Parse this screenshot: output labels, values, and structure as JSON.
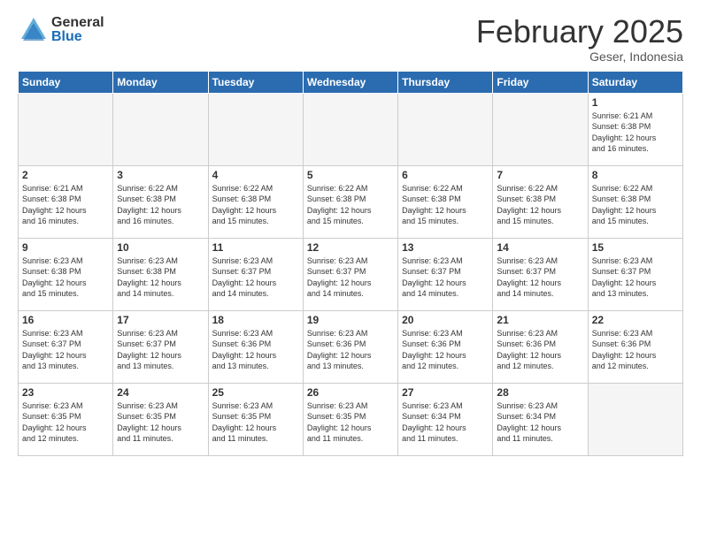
{
  "header": {
    "logo": {
      "general": "General",
      "blue": "Blue"
    },
    "title": "February 2025",
    "subtitle": "Geser, Indonesia"
  },
  "weekdays": [
    "Sunday",
    "Monday",
    "Tuesday",
    "Wednesday",
    "Thursday",
    "Friday",
    "Saturday"
  ],
  "weeks": [
    [
      {
        "day": "",
        "info": ""
      },
      {
        "day": "",
        "info": ""
      },
      {
        "day": "",
        "info": ""
      },
      {
        "day": "",
        "info": ""
      },
      {
        "day": "",
        "info": ""
      },
      {
        "day": "",
        "info": ""
      },
      {
        "day": "1",
        "info": "Sunrise: 6:21 AM\nSunset: 6:38 PM\nDaylight: 12 hours\nand 16 minutes."
      }
    ],
    [
      {
        "day": "2",
        "info": "Sunrise: 6:21 AM\nSunset: 6:38 PM\nDaylight: 12 hours\nand 16 minutes."
      },
      {
        "day": "3",
        "info": "Sunrise: 6:22 AM\nSunset: 6:38 PM\nDaylight: 12 hours\nand 16 minutes."
      },
      {
        "day": "4",
        "info": "Sunrise: 6:22 AM\nSunset: 6:38 PM\nDaylight: 12 hours\nand 15 minutes."
      },
      {
        "day": "5",
        "info": "Sunrise: 6:22 AM\nSunset: 6:38 PM\nDaylight: 12 hours\nand 15 minutes."
      },
      {
        "day": "6",
        "info": "Sunrise: 6:22 AM\nSunset: 6:38 PM\nDaylight: 12 hours\nand 15 minutes."
      },
      {
        "day": "7",
        "info": "Sunrise: 6:22 AM\nSunset: 6:38 PM\nDaylight: 12 hours\nand 15 minutes."
      },
      {
        "day": "8",
        "info": "Sunrise: 6:22 AM\nSunset: 6:38 PM\nDaylight: 12 hours\nand 15 minutes."
      }
    ],
    [
      {
        "day": "9",
        "info": "Sunrise: 6:23 AM\nSunset: 6:38 PM\nDaylight: 12 hours\nand 15 minutes."
      },
      {
        "day": "10",
        "info": "Sunrise: 6:23 AM\nSunset: 6:38 PM\nDaylight: 12 hours\nand 14 minutes."
      },
      {
        "day": "11",
        "info": "Sunrise: 6:23 AM\nSunset: 6:37 PM\nDaylight: 12 hours\nand 14 minutes."
      },
      {
        "day": "12",
        "info": "Sunrise: 6:23 AM\nSunset: 6:37 PM\nDaylight: 12 hours\nand 14 minutes."
      },
      {
        "day": "13",
        "info": "Sunrise: 6:23 AM\nSunset: 6:37 PM\nDaylight: 12 hours\nand 14 minutes."
      },
      {
        "day": "14",
        "info": "Sunrise: 6:23 AM\nSunset: 6:37 PM\nDaylight: 12 hours\nand 14 minutes."
      },
      {
        "day": "15",
        "info": "Sunrise: 6:23 AM\nSunset: 6:37 PM\nDaylight: 12 hours\nand 13 minutes."
      }
    ],
    [
      {
        "day": "16",
        "info": "Sunrise: 6:23 AM\nSunset: 6:37 PM\nDaylight: 12 hours\nand 13 minutes."
      },
      {
        "day": "17",
        "info": "Sunrise: 6:23 AM\nSunset: 6:37 PM\nDaylight: 12 hours\nand 13 minutes."
      },
      {
        "day": "18",
        "info": "Sunrise: 6:23 AM\nSunset: 6:36 PM\nDaylight: 12 hours\nand 13 minutes."
      },
      {
        "day": "19",
        "info": "Sunrise: 6:23 AM\nSunset: 6:36 PM\nDaylight: 12 hours\nand 13 minutes."
      },
      {
        "day": "20",
        "info": "Sunrise: 6:23 AM\nSunset: 6:36 PM\nDaylight: 12 hours\nand 12 minutes."
      },
      {
        "day": "21",
        "info": "Sunrise: 6:23 AM\nSunset: 6:36 PM\nDaylight: 12 hours\nand 12 minutes."
      },
      {
        "day": "22",
        "info": "Sunrise: 6:23 AM\nSunset: 6:36 PM\nDaylight: 12 hours\nand 12 minutes."
      }
    ],
    [
      {
        "day": "23",
        "info": "Sunrise: 6:23 AM\nSunset: 6:35 PM\nDaylight: 12 hours\nand 12 minutes."
      },
      {
        "day": "24",
        "info": "Sunrise: 6:23 AM\nSunset: 6:35 PM\nDaylight: 12 hours\nand 11 minutes."
      },
      {
        "day": "25",
        "info": "Sunrise: 6:23 AM\nSunset: 6:35 PM\nDaylight: 12 hours\nand 11 minutes."
      },
      {
        "day": "26",
        "info": "Sunrise: 6:23 AM\nSunset: 6:35 PM\nDaylight: 12 hours\nand 11 minutes."
      },
      {
        "day": "27",
        "info": "Sunrise: 6:23 AM\nSunset: 6:34 PM\nDaylight: 12 hours\nand 11 minutes."
      },
      {
        "day": "28",
        "info": "Sunrise: 6:23 AM\nSunset: 6:34 PM\nDaylight: 12 hours\nand 11 minutes."
      },
      {
        "day": "",
        "info": ""
      }
    ]
  ]
}
